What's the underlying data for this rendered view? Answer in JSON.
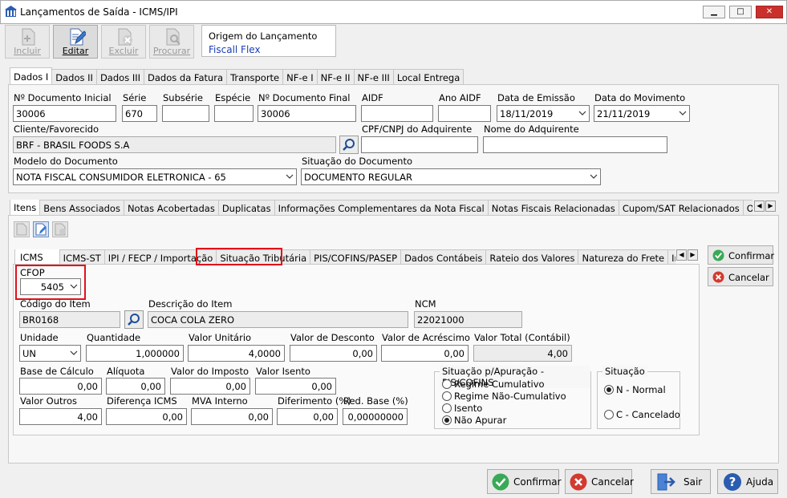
{
  "window": {
    "title": "Lançamentos de Saída - ICMS/IPI",
    "min": "▁",
    "max": "□",
    "close": "✕"
  },
  "toolbar": {
    "incluir": "Incluir",
    "editar": "Editar",
    "excluir": "Excluir",
    "procurar": "Procurar"
  },
  "origem": {
    "label": "Origem do Lançamento",
    "value": "Fiscall Flex"
  },
  "top_tabs": [
    "Dados I",
    "Dados II",
    "Dados III",
    "Dados da Fatura",
    "Transporte",
    "NF-e I",
    "NF-e II",
    "NF-e III",
    "Local Entrega"
  ],
  "fields": {
    "num_doc_ini": {
      "label": "Nº Documento Inicial",
      "value": "30006"
    },
    "serie": {
      "label": "Série",
      "value": "670"
    },
    "subserie": {
      "label": "Subsérie",
      "value": ""
    },
    "especie": {
      "label": "Espécie",
      "value": ""
    },
    "num_doc_fin": {
      "label": "Nº Documento Final",
      "value": "30006"
    },
    "aidf": {
      "label": "AIDF",
      "value": ""
    },
    "ano_aidf": {
      "label": "Ano AIDF",
      "value": ""
    },
    "data_emissao": {
      "label": "Data de Emissão",
      "value": "18/11/2019"
    },
    "data_movimento": {
      "label": "Data do Movimento",
      "value": "21/11/2019"
    },
    "cliente": {
      "label": "Cliente/Favorecido",
      "value": "BRF - BRASIL FOODS S.A"
    },
    "cpf_cnpj": {
      "label": "CPF/CNPJ do Adquirente",
      "value": ""
    },
    "nome_adq": {
      "label": "Nome do Adquirente",
      "value": ""
    },
    "modelo": {
      "label": "Modelo do Documento",
      "value": "NOTA FISCAL CONSUMIDOR ELETRONICA - 65"
    },
    "situacao_doc": {
      "label": "Situação do Documento",
      "value": "DOCUMENTO REGULAR"
    }
  },
  "mid_tabs": [
    "Itens",
    "Bens Associados",
    "Notas Acobertadas",
    "Duplicatas",
    "Informações Complementares da Nota Fiscal",
    "Notas Fiscais Relacionadas",
    "Cupom/SAT Relacionados",
    "Observação d"
  ],
  "item_tabs": [
    "ICMS",
    "ICMS-ST",
    "IPI / FECP / Importação",
    "Situação Tributária",
    "PIS/COFINS/PASEP",
    "Dados Contábeis",
    "Rateio dos Valores",
    "Natureza do Frete",
    "Informações"
  ],
  "item": {
    "cfop": {
      "label": "CFOP",
      "value": "5405"
    },
    "codigo": {
      "label": "Código do Item",
      "value": "BR0168"
    },
    "descricao": {
      "label": "Descrição do Item",
      "value": "COCA COLA ZERO"
    },
    "ncm": {
      "label": "NCM",
      "value": "22021000"
    },
    "unidade": {
      "label": "Unidade",
      "value": "UN"
    },
    "quantidade": {
      "label": "Quantidade",
      "value": "1,000000"
    },
    "valor_unitario": {
      "label": "Valor Unitário",
      "value": "4,0000"
    },
    "valor_desconto": {
      "label": "Valor de Desconto",
      "value": "0,00"
    },
    "valor_acrescimo": {
      "label": "Valor de Acréscimo",
      "value": "0,00"
    },
    "valor_total": {
      "label": "Valor Total (Contábil)",
      "value": "4,00"
    },
    "base_calculo": {
      "label": "Base de Cálculo",
      "value": "0,00"
    },
    "aliquota": {
      "label": "Alíquota",
      "value": "0,00"
    },
    "valor_imposto": {
      "label": "Valor do Imposto",
      "value": "0,00"
    },
    "valor_isento": {
      "label": "Valor Isento",
      "value": "0,00"
    },
    "valor_outros": {
      "label": "Valor Outros",
      "value": "4,00"
    },
    "diferenca_icms": {
      "label": "Diferença ICMS",
      "value": "0,00"
    },
    "mva_interno": {
      "label": "MVA Interno",
      "value": "0,00"
    },
    "diferimento": {
      "label": "Diferimento (%)",
      "value": "0,00"
    },
    "red_base": {
      "label": "Red. Base (%)",
      "value": "0,00000000"
    }
  },
  "apuracao": {
    "title": "Situação p/Apuração - PIS/COFINS",
    "options": [
      "Regime Cumulativo",
      "Regime Não-Cumulativo",
      "Isento",
      "Não Apurar"
    ],
    "selected": 3
  },
  "situacao": {
    "title": "Situação",
    "options": [
      "N - Normal",
      "C - Cancelado"
    ],
    "selected": 0
  },
  "side_buttons": {
    "confirmar": "Confirmar",
    "cancelar": "Cancelar"
  },
  "bottom_buttons": {
    "confirmar": "Confirmar",
    "cancelar": "Cancelar",
    "sair": "Sair",
    "ajuda": "Ajuda"
  },
  "colors": {
    "highlight": "#e0121b",
    "link": "#1a3eb5",
    "ok": "#3aa957",
    "cancel": "#d23a2f",
    "help": "#2a5db0"
  }
}
